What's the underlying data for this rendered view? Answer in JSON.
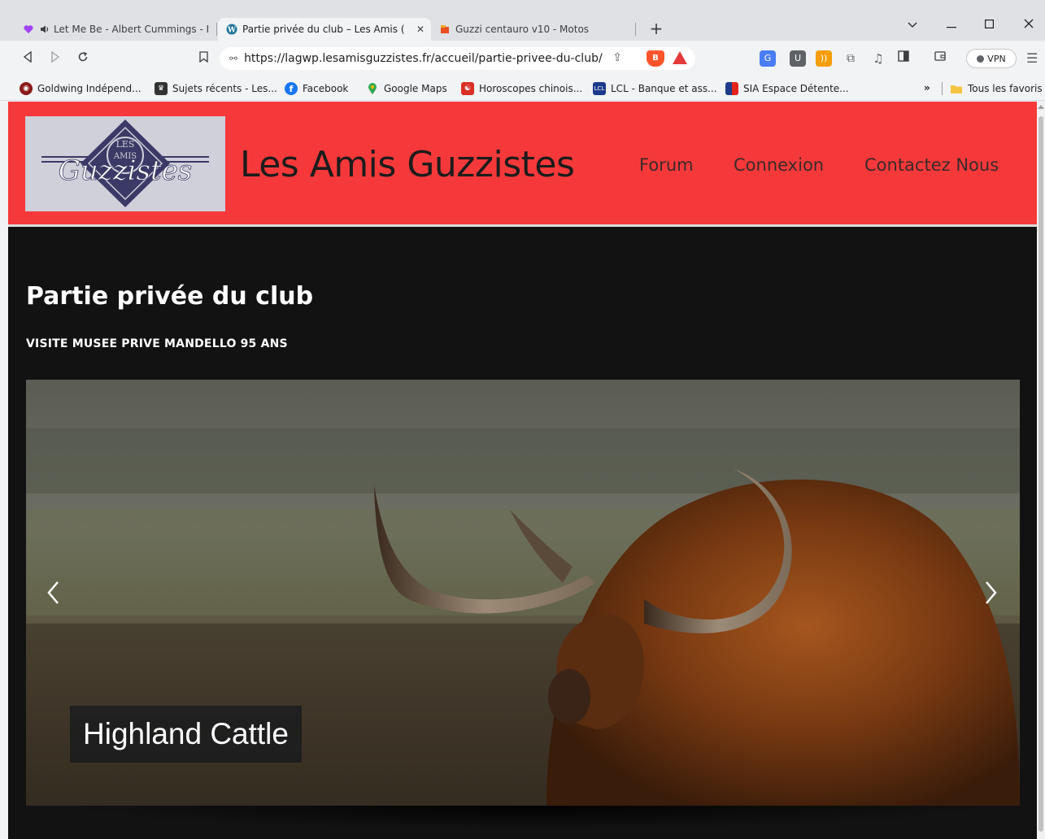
{
  "tabs": [
    {
      "label": "Let Me Be - Albert Cummings - De",
      "active": false
    },
    {
      "label": "Partie privée du club – Les Amis (",
      "active": true
    },
    {
      "label": "Guzzi centauro v10 - Motos",
      "active": false
    }
  ],
  "toolbar": {
    "url": "https://lagwp.lesamisguzzistes.fr/accueil/partie-privee-du-club/",
    "vpn_label": "VPN"
  },
  "bookmarks": [
    {
      "label": "Goldwing Indépend...",
      "color": "#c0392b"
    },
    {
      "label": "Sujets récents - Les...",
      "color": "#333333"
    },
    {
      "label": "Facebook",
      "color": "#1877f2"
    },
    {
      "label": "Google Maps",
      "color": "#34a853"
    },
    {
      "label": "Horoscopes chinois...",
      "color": "#d93025"
    },
    {
      "label": "LCL - Banque et ass...",
      "color": "#1b3a8c"
    },
    {
      "label": "SIA Espace Détente...",
      "color": "#1f3c88"
    }
  ],
  "bookmarks_more": "»",
  "bookmarks_folder": "Tous les favoris",
  "site": {
    "title": "Les Amis Guzzistes",
    "logo_text_top": "LES",
    "logo_text_mid": "AMIS",
    "logo_script": "Guzzistes",
    "nav": [
      "Forum",
      "Connexion",
      "Contactez Nous"
    ],
    "header_color": "#f5393a"
  },
  "page": {
    "heading": "Partie privée du club",
    "subheading": "VISITE MUSEE PRIVE MANDELLO 95 ANS",
    "slide_caption": "Highland Cattle"
  },
  "icons": {
    "prev": "chevron-left-icon",
    "next": "chevron-right-icon"
  }
}
